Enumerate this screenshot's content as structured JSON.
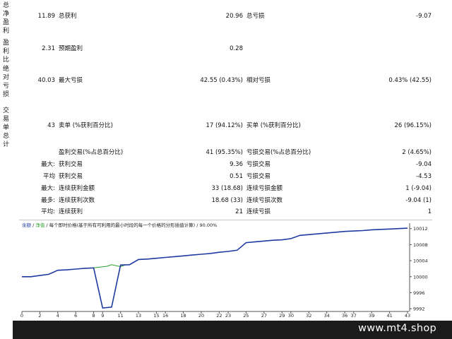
{
  "vertical_labels": [
    "总净盈利",
    "盈利比",
    "绝对亏损",
    "交易单总计"
  ],
  "rows": [
    {
      "label_a": "",
      "val_a": "11.89",
      "label_b": "总获利",
      "val_b": "20.96",
      "label_c": "总亏损",
      "val_c": "-9.07"
    },
    {
      "label_a": "",
      "val_a": "2.31",
      "label_b": "预期盈利",
      "val_b": "0.28",
      "label_c": "",
      "val_c": ""
    },
    {
      "label_a": "",
      "val_a": "40.03",
      "label_b": "最大亏损",
      "val_b": "42.55 (0.43%)",
      "label_c": "相对亏损",
      "val_c": "0.43% (42.55)"
    },
    {
      "label_a": "",
      "val_a": "43",
      "label_b": "卖单 (%获利百分比)",
      "val_b": "17 (94.12%)",
      "label_c": "买单 (%获利百分比)",
      "val_c": "26 (96.15%)"
    },
    {
      "label_a": "",
      "val_a": "",
      "label_b": "盈利交易(%占总百分比)",
      "val_b": "41 (95.35%)",
      "label_c": "亏损交易(%占总百分比)",
      "val_c": "2 (4.65%)"
    },
    {
      "label_a": "最大:",
      "val_a": "",
      "label_b": "获利交易",
      "val_b": "9.36",
      "label_c": "亏损交易",
      "val_c": "-9.04"
    },
    {
      "label_a": "平均",
      "val_a": "",
      "label_b": "获利交易",
      "val_b": "0.51",
      "label_c": "亏损交易",
      "val_c": "-4.53"
    },
    {
      "label_a": "最大:",
      "val_a": "",
      "label_b": "连续获利金额",
      "val_b": "33 (18.68)",
      "label_c": "连续亏损金额",
      "val_c": "1 (-9.04)"
    },
    {
      "label_a": "最多:",
      "val_a": "",
      "label_b": "连续获利次数",
      "val_b": "18.68 (33)",
      "label_c": "连续亏损次数",
      "val_c": "-9.04 (1)"
    },
    {
      "label_a": "平均:",
      "val_a": "",
      "label_b": "连续获利",
      "val_b": "21",
      "label_c": "连续亏损",
      "val_c": "1"
    }
  ],
  "chart_legend": {
    "balance": "余额",
    "sep1": " / ",
    "equity": "净值",
    "rest": " / 每个即时价格(基于所有可利用的最小时段的每一个价格的分形插值计算) / 90.00%"
  },
  "colors": {
    "balance": "#1f3aa0",
    "equity": "#2a9d2a",
    "footer_bg": "#1b1b1b"
  },
  "chart_data": {
    "type": "line",
    "title": "",
    "xlabel": "",
    "ylabel": "",
    "x_ticks": [
      0,
      2,
      4,
      6,
      8,
      9,
      11,
      13,
      15,
      16,
      18,
      20,
      22,
      23,
      25,
      27,
      29,
      30,
      32,
      34,
      36,
      37,
      39,
      41,
      43
    ],
    "y_ticks": [
      10012,
      10008,
      10004,
      10000,
      9996,
      9992
    ],
    "xlim": [
      0,
      43
    ],
    "ylim": [
      9991.5,
      10012.3
    ],
    "series": [
      {
        "name": "余额",
        "x": [
          0,
          1,
          2,
          3,
          4,
          5,
          6,
          7,
          8,
          9,
          10,
          11,
          12,
          13,
          14,
          15,
          16,
          17,
          18,
          19,
          20,
          21,
          22,
          23,
          24,
          25,
          26,
          27,
          28,
          29,
          30,
          31,
          32,
          33,
          34,
          35,
          36,
          37,
          38,
          39,
          40,
          41,
          42,
          43
        ],
        "y": [
          10000,
          10000,
          10000.3,
          10000.6,
          10001.6,
          10001.7,
          10001.9,
          10002.1,
          10002.2,
          9992.2,
          9992.4,
          10002.9,
          10003.0,
          10004.3,
          10004.4,
          10004.6,
          10004.8,
          10005.0,
          10005.2,
          10005.4,
          10005.6,
          10005.8,
          10006.1,
          10006.3,
          10006.6,
          10008.5,
          10008.7,
          10008.9,
          10009.1,
          10009.2,
          10009.5,
          10010.3,
          10010.5,
          10010.7,
          10010.9,
          10011.1,
          10011.3,
          10011.4,
          10011.5,
          10011.7,
          10011.8,
          10011.9,
          10012.0,
          10012.1
        ]
      },
      {
        "name": "净值",
        "x": [
          8,
          9.5,
          10,
          11,
          11.5
        ],
        "y": [
          10002.2,
          10002.6,
          10003.0,
          10002.5,
          10002.9
        ]
      }
    ],
    "grid": false,
    "legend": "top-left"
  },
  "footer": {
    "site": "www.mt4.shop"
  }
}
